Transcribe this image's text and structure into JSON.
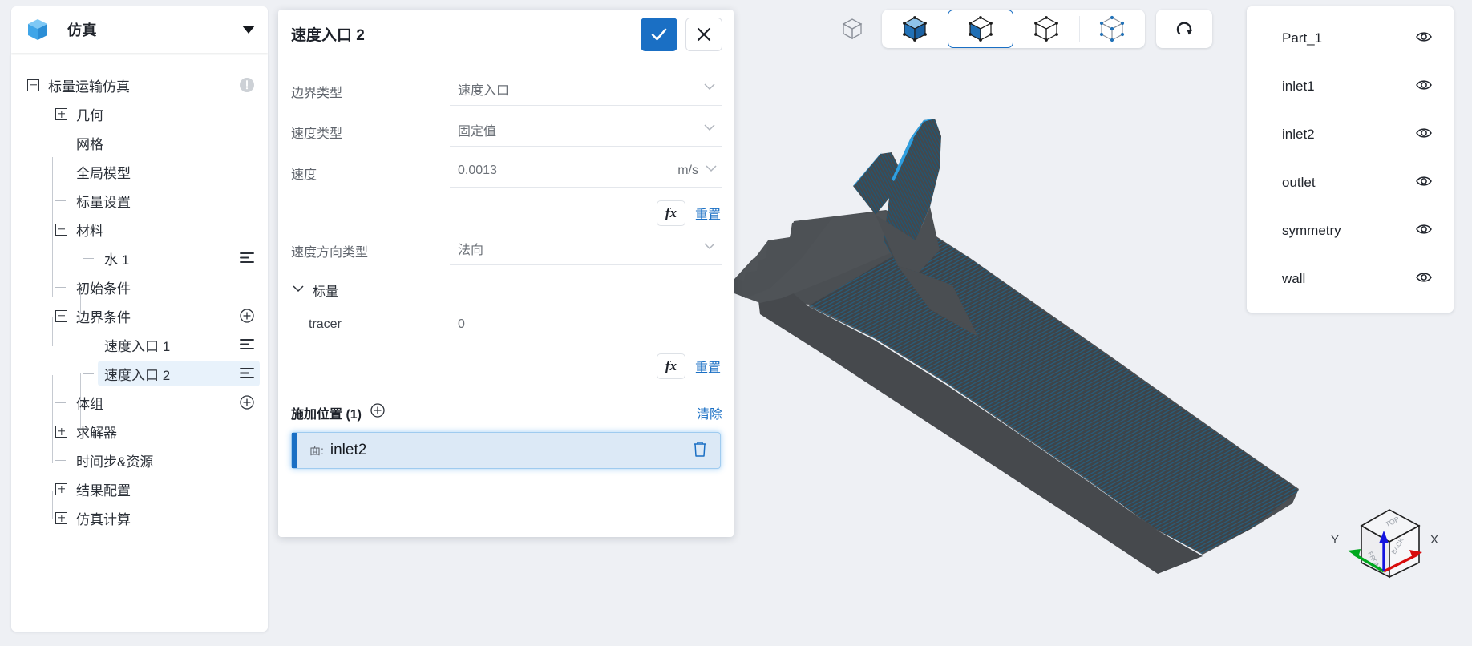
{
  "sidebar": {
    "title": "仿真",
    "logo_icon": "cube-logo-icon",
    "caret_icon": "chevron-down-icon",
    "tree": [
      {
        "label": "标量运输仿真",
        "toggle": "minus",
        "indent": 0,
        "action": "warning",
        "selected": false
      },
      {
        "label": "几何",
        "toggle": "plus",
        "indent": 1,
        "action": "none",
        "selected": false
      },
      {
        "label": "网格",
        "toggle": "leaf",
        "indent": 1,
        "action": "none",
        "selected": false
      },
      {
        "label": "全局模型",
        "toggle": "leaf",
        "indent": 1,
        "action": "none",
        "selected": false
      },
      {
        "label": "标量设置",
        "toggle": "leaf",
        "indent": 1,
        "action": "none",
        "selected": false
      },
      {
        "label": "材料",
        "toggle": "minus",
        "indent": 1,
        "action": "none",
        "selected": false
      },
      {
        "label": "水 1",
        "toggle": "leaf",
        "indent": 2,
        "action": "menu",
        "selected": false
      },
      {
        "label": "初始条件",
        "toggle": "leaf",
        "indent": 1,
        "action": "none",
        "selected": false
      },
      {
        "label": "边界条件",
        "toggle": "minus",
        "indent": 1,
        "action": "add",
        "selected": false
      },
      {
        "label": "速度入口 1",
        "toggle": "leaf",
        "indent": 2,
        "action": "menu",
        "selected": false
      },
      {
        "label": "速度入口 2",
        "toggle": "leaf",
        "indent": 2,
        "action": "menu",
        "selected": true
      },
      {
        "label": "体组",
        "toggle": "leaf",
        "indent": 1,
        "action": "add",
        "selected": false
      },
      {
        "label": "求解器",
        "toggle": "plus",
        "indent": 1,
        "action": "none",
        "selected": false
      },
      {
        "label": "时间步&资源",
        "toggle": "leaf",
        "indent": 1,
        "action": "none",
        "selected": false
      },
      {
        "label": "结果配置",
        "toggle": "plus",
        "indent": 1,
        "action": "none",
        "selected": false
      },
      {
        "label": "仿真计算",
        "toggle": "plus",
        "indent": 1,
        "action": "none",
        "selected": false
      }
    ]
  },
  "dialog": {
    "title": "速度入口 2",
    "confirm_icon": "check-icon",
    "cancel_icon": "close-icon",
    "fields": [
      {
        "label": "边界类型",
        "value": "速度入口",
        "unit": null,
        "icon": "chevron-down-icon"
      },
      {
        "label": "速度类型",
        "value": "固定值",
        "unit": null,
        "icon": "chevron-down-icon"
      },
      {
        "label": "速度",
        "value": "0.0013",
        "unit": "m/s",
        "icon": "chevron-down-icon"
      }
    ],
    "direction_field": {
      "label": "速度方向类型",
      "value": "法向",
      "icon": "chevron-down-icon"
    },
    "fx_label": "fx",
    "reset_label": "重置",
    "scalar_section": {
      "label": "标量",
      "expand_icon": "chevron-down-icon"
    },
    "scalar_rows": [
      {
        "label": "tracer",
        "value": "0"
      }
    ],
    "apply": {
      "title": "施加位置 (1)",
      "add_icon": "circle-plus-icon",
      "clear_label": "清除",
      "items": [
        {
          "kind": "面:",
          "name": "inlet2",
          "delete_icon": "trash-icon"
        }
      ]
    }
  },
  "toolbar": {
    "standalone_icon": "cube-outline-icon",
    "modes": [
      {
        "icon": "cube-solid-icon",
        "name": "body-select-mode",
        "active": false
      },
      {
        "icon": "cube-face-icon",
        "name": "face-select-mode",
        "active": true
      },
      {
        "icon": "cube-edge-icon",
        "name": "edge-select-mode",
        "active": false
      },
      {
        "icon": "cube-vertex-icon",
        "name": "vertex-select-mode",
        "active": false
      }
    ],
    "reset_icon": "rotate-reset-icon"
  },
  "parts_panel": {
    "items": [
      {
        "name": "Part_1",
        "visibility_icon": "eye-icon"
      },
      {
        "name": "inlet1",
        "visibility_icon": "eye-icon"
      },
      {
        "name": "inlet2",
        "visibility_icon": "eye-icon"
      },
      {
        "name": "outlet",
        "visibility_icon": "eye-icon"
      },
      {
        "name": "symmetry",
        "visibility_icon": "eye-icon"
      },
      {
        "name": "wall",
        "visibility_icon": "eye-icon"
      }
    ]
  },
  "gizmo": {
    "axis_x": "X",
    "axis_y": "Y",
    "face_top": "TOP",
    "face_front": "FRONT",
    "face_back": "BACK",
    "color_x": "#d80b0b",
    "color_y": "#00a81e",
    "color_z": "#1414e0"
  },
  "viewport": {
    "background": "#eef0f4",
    "model_color": "#4b4f53",
    "model_highlight_color": "#1f5d80"
  }
}
